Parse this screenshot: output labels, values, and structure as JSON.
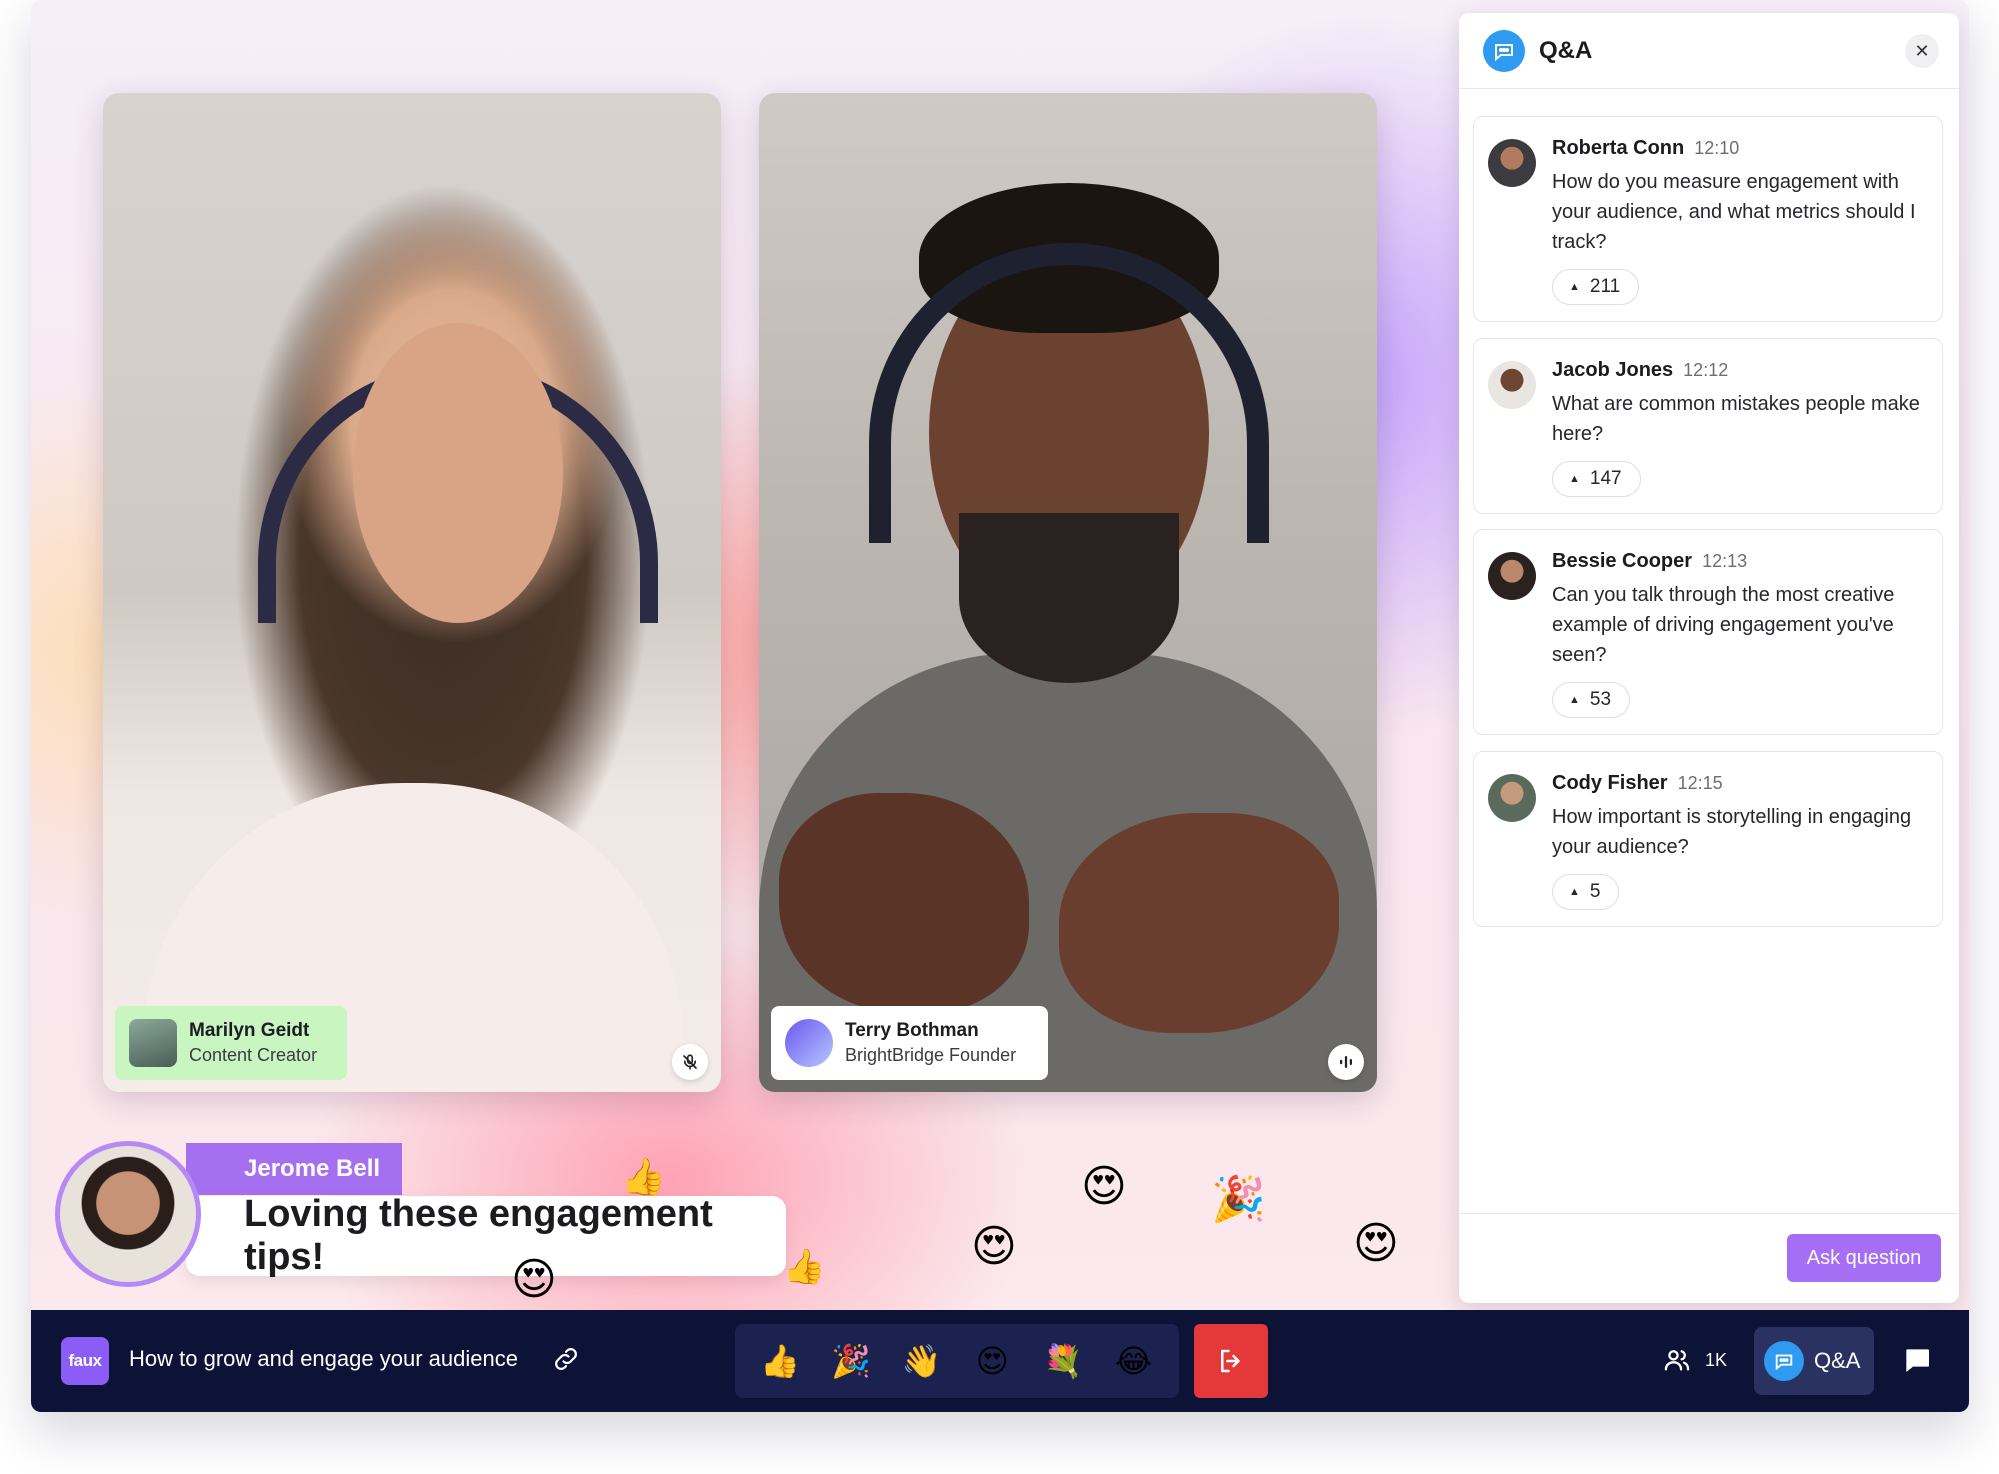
{
  "stage": {
    "speakers": [
      {
        "name": "Marilyn Geidt",
        "role": "Content Creator",
        "mic_icon": "mic-off-icon"
      },
      {
        "name": "Terry Bothman",
        "role": "BrightBridge Founder",
        "mic_icon": "audio-wave-icon"
      }
    ],
    "chat_highlight": {
      "name": "Jerome Bell",
      "message": "Loving these engagement tips!"
    },
    "floating_emojis": [
      "😍",
      "😍",
      "😍",
      "😍",
      "🎉",
      "👍",
      "👍"
    ]
  },
  "qa": {
    "title": "Q&A",
    "close_icon": "close-icon",
    "questions": [
      {
        "name": "Roberta Conn",
        "time": "12:10",
        "text": "How do you measure engagement with your audience, and what metrics should I track?",
        "votes": "211"
      },
      {
        "name": "Jacob Jones",
        "time": "12:12",
        "text": "What are common mistakes people make here?",
        "votes": "147"
      },
      {
        "name": "Bessie Cooper",
        "time": "12:13",
        "text": "Can you talk through the most creative example of driving engagement you've seen?",
        "votes": "53"
      },
      {
        "name": "Cody Fisher",
        "time": "12:15",
        "text": "How important is storytelling in engaging your audience?",
        "votes": "5"
      }
    ],
    "ask_button": "Ask question"
  },
  "bottombar": {
    "brand": "faux",
    "session_title": "How to grow and engage your audience",
    "reactions": [
      "👍",
      "🎉",
      "👋",
      "😍",
      "💐",
      "😂"
    ],
    "attendee_count": "1K",
    "qa_label": "Q&A"
  },
  "colors": {
    "accent": "#a66ef5",
    "bar": "#0d1237",
    "leave": "#e53838",
    "speaker1_tag": "#c8f5c0"
  }
}
